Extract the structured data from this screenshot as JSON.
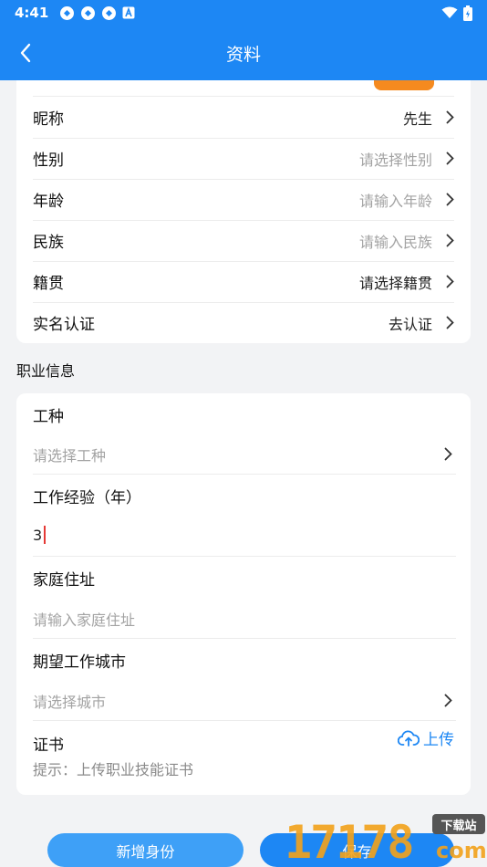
{
  "status_bar": {
    "time": "4:41",
    "notification_icons": [
      "app-icon",
      "app-icon",
      "app-icon",
      "a-badge-icon"
    ],
    "right_icons": [
      "wifi-icon",
      "battery-icon"
    ]
  },
  "app_bar": {
    "title": "资料",
    "back_icon": "chevron-left-icon"
  },
  "profile_rows": [
    {
      "label": "昵称",
      "value": "先生",
      "placeholder": false
    },
    {
      "label": "性别",
      "value": "请选择性别",
      "placeholder": true
    },
    {
      "label": "年龄",
      "value": "请输入年龄",
      "placeholder": true
    },
    {
      "label": "民族",
      "value": "请输入民族",
      "placeholder": true
    },
    {
      "label": "籍贯",
      "value": "请选择籍贯",
      "placeholder": false
    },
    {
      "label": "实名认证",
      "value": "去认证",
      "placeholder": false
    }
  ],
  "career_section": {
    "title": "职业信息",
    "job_type": {
      "label": "工种",
      "placeholder": "请选择工种"
    },
    "experience": {
      "label": "工作经验（年）",
      "value": "3"
    },
    "home_address": {
      "label": "家庭住址",
      "placeholder": "请输入家庭住址"
    },
    "expected_city": {
      "label": "期望工作城市",
      "placeholder": "请选择城市"
    },
    "certificate": {
      "label": "证书",
      "upload_label": "上传",
      "hint": "提示：上传职业技能证书"
    }
  },
  "actions": {
    "add_identity": "新增身份",
    "save": "保存"
  },
  "watermark": {
    "numbers": "17178",
    "suffix": "com",
    "tag": "下载站"
  },
  "colors": {
    "primary": "#1d87f4",
    "placeholder": "#a3a3a3",
    "accent_orange": "#f58a1f"
  }
}
